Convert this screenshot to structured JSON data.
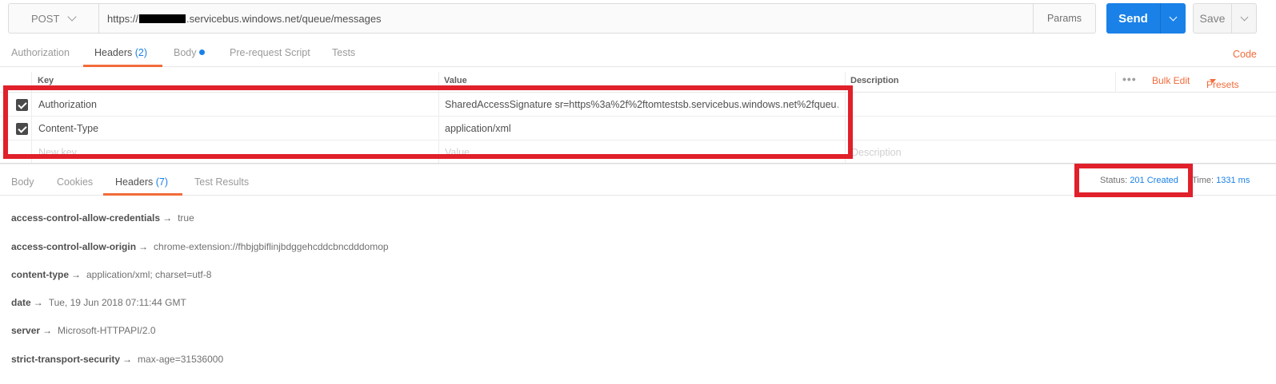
{
  "request": {
    "method": "POST",
    "url_prefix": "https://",
    "url_suffix": ".servicebus.windows.net/queue/messages",
    "params_label": "Params",
    "send_label": "Send",
    "save_label": "Save"
  },
  "request_tabs": {
    "authorization": "Authorization",
    "headers": "Headers",
    "headers_count": "(2)",
    "body": "Body",
    "prerequest": "Pre-request Script",
    "tests": "Tests",
    "code": "Code"
  },
  "headers_table": {
    "col_key": "Key",
    "col_value": "Value",
    "col_description": "Description",
    "more": "•••",
    "bulk_edit": "Bulk Edit",
    "presets": "Presets",
    "rows": [
      {
        "key": "Authorization",
        "value": "SharedAccessSignature sr=https%3a%2f%2ftomtestsb.servicebus.windows.net%2fqueu…",
        "checked": true
      },
      {
        "key": "Content-Type",
        "value": "application/xml",
        "checked": true
      }
    ],
    "new_key_placeholder": "New key",
    "value_placeholder": "Value",
    "description_placeholder": "Description"
  },
  "response_tabs": {
    "body": "Body",
    "cookies": "Cookies",
    "headers": "Headers",
    "headers_count": "(7)",
    "test_results": "Test Results"
  },
  "response_meta": {
    "status_label": "Status:",
    "status_value": "201 Created",
    "time_label": "Time:",
    "time_value": "1331 ms"
  },
  "response_headers": [
    {
      "key": "access-control-allow-credentials",
      "value": "true"
    },
    {
      "key": "access-control-allow-origin",
      "value": "chrome-extension://fhbjgbiflinjbdggehcddcbncdddomop"
    },
    {
      "key": "content-type",
      "value": "application/xml; charset=utf-8"
    },
    {
      "key": "date",
      "value": "Tue, 19 Jun 2018 07:11:44 GMT"
    },
    {
      "key": "server",
      "value": "Microsoft-HTTPAPI/2.0"
    },
    {
      "key": "strict-transport-security",
      "value": "max-age=31536000"
    }
  ],
  "arrow_glyph": "→",
  "colors": {
    "accent_blue": "#1a81e8",
    "accent_orange": "#f26b3a",
    "highlight_red": "#e0202a"
  }
}
